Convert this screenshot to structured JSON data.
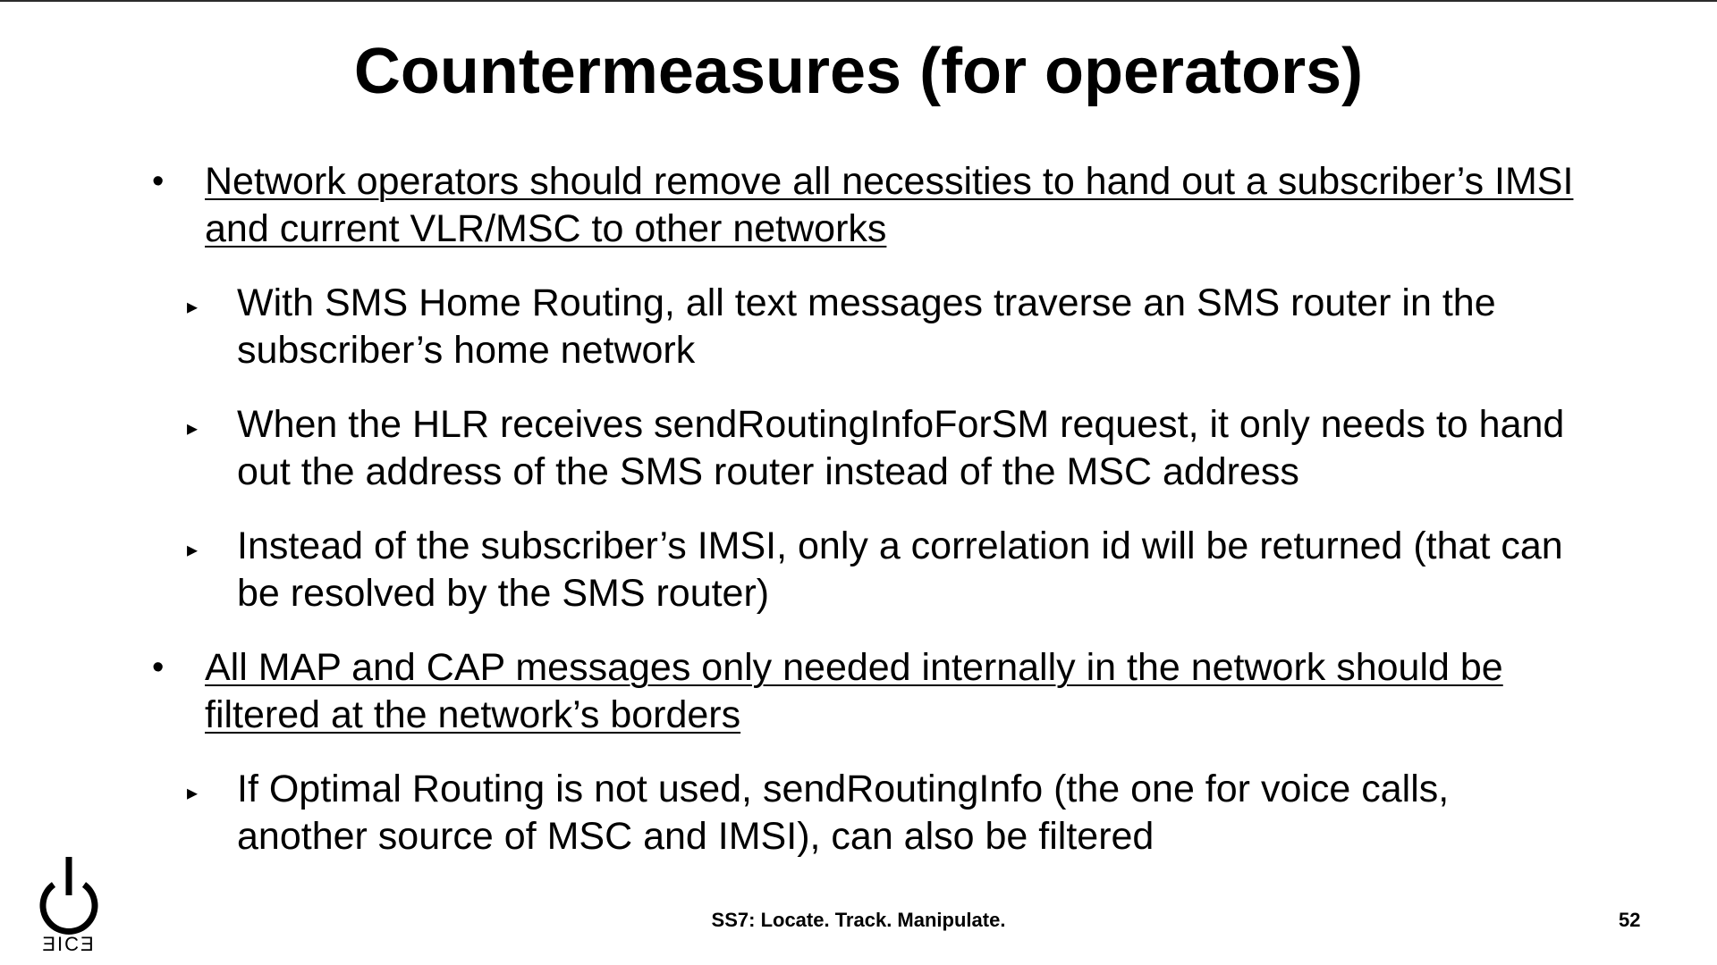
{
  "slide": {
    "title": "Countermeasures (for operators)",
    "bullets": [
      {
        "marker": "•",
        "text": "Network operators should remove all necessities to hand out a subscriber’s IMSI and current VLR/MSC to other networks"
      },
      {
        "marker": "▸",
        "text": "With SMS Home Routing, all text messages traverse an SMS router in the subscriber’s home network"
      },
      {
        "marker": "▸",
        "text": "When the HLR receives sendRoutingInfoForSM request, it only needs to hand out the address of the SMS router instead of the MSC address"
      },
      {
        "marker": "▸",
        "text": "Instead of the subscriber’s IMSI, only a correlation id will be returned (that can be resolved by the SMS router)"
      },
      {
        "marker": "•",
        "text": "All MAP and CAP messages only needed internally in the network should be filtered at the network’s borders"
      },
      {
        "marker": "▸",
        "text": "If Optimal Routing is not used, sendRoutingInfo (the one for voice calls, another source of MSC and IMSI), can also be filtered"
      }
    ]
  },
  "footer": {
    "caption": "SS7: Locate. Track. Manipulate.",
    "page_number": "52"
  },
  "logo": {
    "icon": "power-icon",
    "wordmark": "ƎICƎ"
  }
}
